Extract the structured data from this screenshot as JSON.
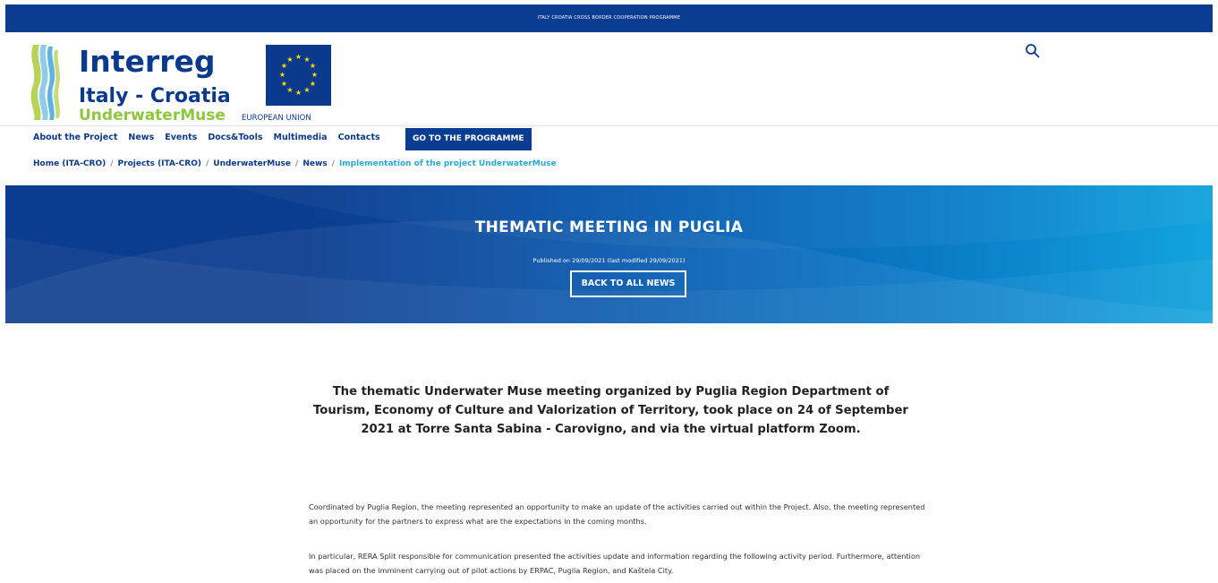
{
  "topbar": {
    "text": "ITALY CROATIA CROSS BORDER COOPERATION PROGRAMME"
  },
  "logo": {
    "brand": "Interreg",
    "region": "Italy - Croatia",
    "project": "UnderwaterMuse",
    "eu_label": "EUROPEAN UNION"
  },
  "nav": {
    "items": [
      {
        "label": "About the Project"
      },
      {
        "label": "News"
      },
      {
        "label": "Events"
      },
      {
        "label": "Docs&Tools"
      },
      {
        "label": "Multimedia"
      },
      {
        "label": "Contacts"
      }
    ],
    "cta_label": "GO TO THE PROGRAMME"
  },
  "breadcrumb": {
    "items": [
      {
        "label": "Home (ITA-CRO)"
      },
      {
        "label": "Projects (ITA-CRO)"
      },
      {
        "label": "UnderwaterMuse"
      },
      {
        "label": "News"
      }
    ],
    "separator": "/",
    "current": "Implementation of the project UnderwaterMuse"
  },
  "hero": {
    "title": "THEMATIC MEETING IN PUGLIA",
    "meta": "Published on 29/09/2021 (last modified 29/09/2021)",
    "back_label": "BACK TO ALL NEWS"
  },
  "article": {
    "lead": "The thematic Underwater Muse meeting organized by Puglia Region Department of Tourism, Economy of Culture and Valorization of Territory, took place on 24 of September 2021 at Torre Santa Sabina - Carovigno, and via the virtual platform Zoom.",
    "paragraph_1": "Coordinated by Puglia Region, the meeting represented an opportunity to make an update of the activities carried out within the Project. Also, the meeting represented an opportunity for the partners to express what are the expectations in the coming months.",
    "paragraph_2": "In particular, RERA Split responsible for communication presented the activities update and information regarding the following activity period. Furthermore, attention was placed on the imminent carrying out of pilot actions by ERPAC, Puglia Region, and Kaštela City."
  },
  "icons": {
    "search": "search-icon",
    "logo_waves": "interreg-waves-logo",
    "eu_flag": "eu-flag-icon"
  },
  "colors": {
    "primary": "#0a3d91",
    "accent_light": "#12a4dd",
    "breadcrumb_current": "#2aa9d8",
    "project_green": "#8dc63f"
  }
}
